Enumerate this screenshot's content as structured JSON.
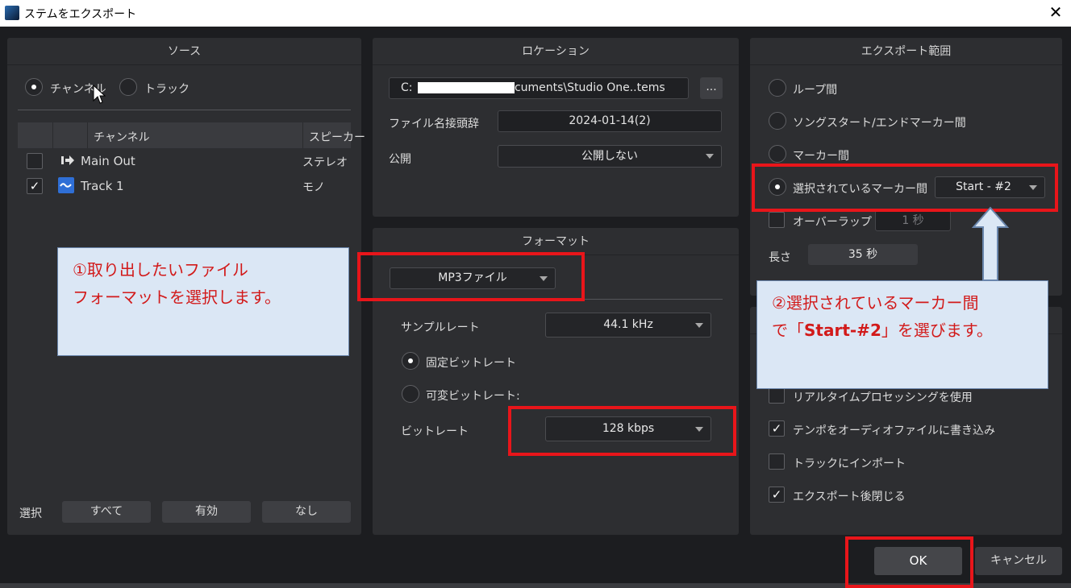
{
  "window": {
    "title": "ステムをエクスポート",
    "close_glyph": "✕"
  },
  "source": {
    "header": "ソース",
    "radio_channel": "チャンネル",
    "radio_track": "トラック",
    "columns": [
      "チャンネル",
      "スピーカー"
    ],
    "rows": [
      {
        "name": "Main Out",
        "speaker": "ステレオ",
        "checked": false,
        "icon": "output-arrow-icon"
      },
      {
        "name": "Track 1",
        "speaker": "モノ",
        "checked": true,
        "icon": "audio-wave-icon"
      }
    ],
    "select_label": "選択",
    "btn_all": "すべて",
    "btn_active": "有効",
    "btn_none": "なし"
  },
  "location": {
    "header": "ロケーション",
    "path": "C:",
    "path_tail": "cuments\\Studio One..tems",
    "browse": "...",
    "prefix_label": "ファイル名接頭辞",
    "prefix_value": "2024-01-14(2)",
    "publish_label": "公開",
    "publish_value": "公開しない"
  },
  "format": {
    "header": "フォーマット",
    "file_type": "MP3ファイル",
    "sample_rate_label": "サンプルレート",
    "sample_rate_value": "44.1 kHz",
    "cbr_label": "固定ビットレート",
    "vbr_label": "可変ビットレート:",
    "bitrate_label": "ビットレート",
    "bitrate_value": "128 kbps"
  },
  "range": {
    "header": "エクスポート範囲",
    "loop": "ループ間",
    "song": "ソングスタート/エンドマーカー間",
    "marker": "マーカー間",
    "selected_marker": "選択されているマーカー間",
    "selected_marker_value": "Start - #2",
    "overlap_label": "オーバーラップ",
    "overlap_value": "1 秒",
    "length_label": "長さ",
    "length_value": "35 秒"
  },
  "options": {
    "realtime": "リアルタイムプロセッシングを使用",
    "tempo": "テンポをオーディオファイルに書き込み",
    "import": "トラックにインポート",
    "close_after": "エクスポート後閉じる"
  },
  "footer": {
    "ok": "OK",
    "cancel": "キャンセル"
  },
  "annotations": {
    "note1_line1": "①取り出したいファイル",
    "note1_line2": "フォーマットを選択します。",
    "note2_line1": "②選択されているマーカー間",
    "note2_line2_a": "で「",
    "note2_line2_b": "Start-#2",
    "note2_line2_c": "」を選びます。"
  },
  "colors": {
    "highlight": "#e8151a",
    "note_bg": "#dbe7f5",
    "note_text": "#d21a1a",
    "panel": "#2d2e31",
    "accent_blue": "#2f6fd6"
  }
}
